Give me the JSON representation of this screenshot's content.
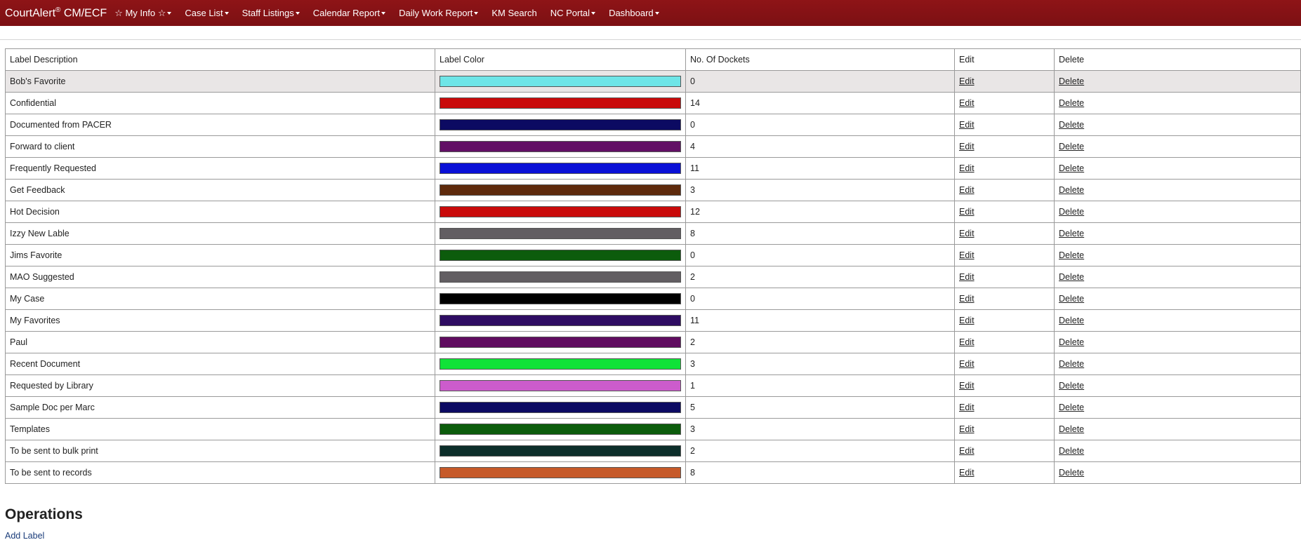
{
  "brand": {
    "name": "CourtAlert",
    "reg": "®",
    "suffix": " CM/ECF"
  },
  "nav": [
    {
      "label": "☆ My Info ☆",
      "caret": true
    },
    {
      "label": "Case List",
      "caret": true
    },
    {
      "label": "Staff Listings",
      "caret": true
    },
    {
      "label": "Calendar Report",
      "caret": true
    },
    {
      "label": "Daily Work Report",
      "caret": true
    },
    {
      "label": "KM Search",
      "caret": false
    },
    {
      "label": "NC Portal",
      "caret": true
    },
    {
      "label": "Dashboard",
      "caret": true
    }
  ],
  "table": {
    "headers": [
      "Label Description",
      "Label Color",
      "No. Of Dockets",
      "Edit",
      "Delete"
    ],
    "edit_label": "Edit",
    "delete_label": "Delete",
    "rows": [
      {
        "description": "Bob's Favorite",
        "color": "#6ee5e7",
        "dockets": "0"
      },
      {
        "description": "Confidential",
        "color": "#c90a0a",
        "dockets": "14"
      },
      {
        "description": "Documented from PACER",
        "color": "#0c0a62",
        "dockets": "0"
      },
      {
        "description": "Forward to client",
        "color": "#621065",
        "dockets": "4"
      },
      {
        "description": "Frequently Requested",
        "color": "#0a10d6",
        "dockets": "11"
      },
      {
        "description": "Get Feedback",
        "color": "#5e2a0c",
        "dockets": "3"
      },
      {
        "description": "Hot Decision",
        "color": "#c90a0a",
        "dockets": "12"
      },
      {
        "description": "Izzy New Lable",
        "color": "#625e62",
        "dockets": "8"
      },
      {
        "description": "Jims Favorite",
        "color": "#0c5c0c",
        "dockets": "0"
      },
      {
        "description": "MAO Suggested",
        "color": "#625e62",
        "dockets": "2"
      },
      {
        "description": "My Case",
        "color": "#000000",
        "dockets": "0"
      },
      {
        "description": "My Favorites",
        "color": "#2e0c62",
        "dockets": "11"
      },
      {
        "description": "Paul",
        "color": "#600c60",
        "dockets": "2"
      },
      {
        "description": "Recent Document",
        "color": "#10e238",
        "dockets": "3"
      },
      {
        "description": "Requested by Library",
        "color": "#cc5ccc",
        "dockets": "1"
      },
      {
        "description": "Sample Doc per Marc",
        "color": "#0c0a62",
        "dockets": "5"
      },
      {
        "description": "Templates",
        "color": "#0c5c0c",
        "dockets": "3"
      },
      {
        "description": "To be sent to bulk print",
        "color": "#0c2e2a",
        "dockets": "2"
      },
      {
        "description": "To be sent to records",
        "color": "#c65a2a",
        "dockets": "8"
      }
    ]
  },
  "operations": {
    "title": "Operations",
    "add_label": "Add Label"
  }
}
